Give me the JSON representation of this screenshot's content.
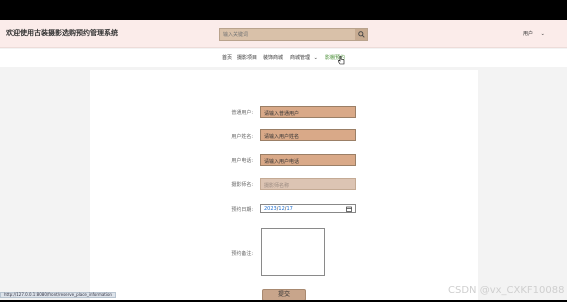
{
  "header": {
    "site_title": "欢迎使用古装摄影选购预约管理系统",
    "search_placeholder": "输入关键词",
    "user_menu": "用户",
    "user_menu_arrow": "⌄"
  },
  "nav": {
    "items": [
      {
        "label": "首页"
      },
      {
        "label": "摄影项目"
      },
      {
        "label": "装饰商城"
      },
      {
        "label": "商城管理"
      },
      {
        "label": "影棚预约"
      }
    ],
    "active_index": 4,
    "dropdown_arrow": "⌄"
  },
  "form": {
    "fields": [
      {
        "label": "普通用户:",
        "value": "请输入普通用户",
        "disabled": false
      },
      {
        "label": "用户姓名:",
        "value": "请输入用户姓名",
        "disabled": false
      },
      {
        "label": "用户电话:",
        "value": "请输入用户电话",
        "disabled": false
      },
      {
        "label": "摄影师名:",
        "value": "摄影师名称",
        "disabled": true
      }
    ],
    "date_label": "预约日期:",
    "date_value": {
      "year": "2023",
      "sep1": "/",
      "month": "12",
      "sep2": "/",
      "day": "17"
    },
    "note_label": "预约备注:",
    "submit_label": "提交"
  },
  "status_url": "http://127.0.0.1:8080/front/reserve_place_information",
  "watermark": "CSDN @vx_CXKF10088",
  "colors": {
    "header_bg": "#fbecea",
    "field_bg": "#d9a988",
    "active_nav": "#4a8f36",
    "submit_bg": "#c8a58b"
  }
}
